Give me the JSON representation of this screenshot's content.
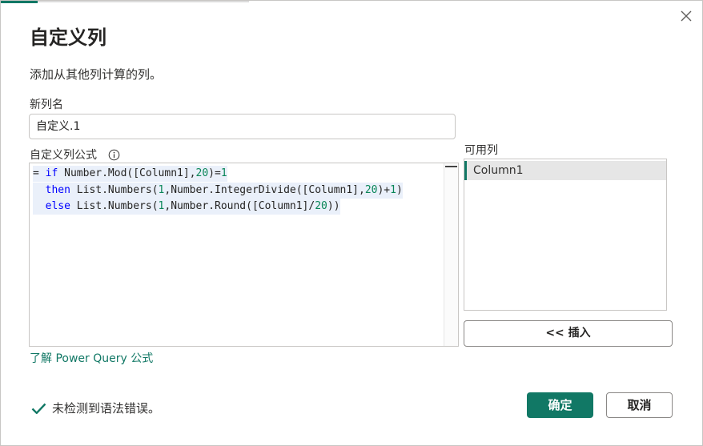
{
  "dialog": {
    "title": "自定义列",
    "subtitle": "添加从其他列计算的列。"
  },
  "new_column": {
    "label": "新列名",
    "value": "自定义.1"
  },
  "formula": {
    "label": "自定义列公式",
    "lines": [
      [
        {
          "t": "= ",
          "c": "plain"
        },
        {
          "t": "if",
          "c": "kw"
        },
        {
          "t": " Number.Mod([Column1],",
          "c": "plain"
        },
        {
          "t": "20",
          "c": "num"
        },
        {
          "t": ")=",
          "c": "plain"
        },
        {
          "t": "1",
          "c": "num"
        }
      ],
      [
        {
          "t": "  ",
          "c": "plain"
        },
        {
          "t": "then",
          "c": "kw"
        },
        {
          "t": " List.Numbers(",
          "c": "plain"
        },
        {
          "t": "1",
          "c": "num"
        },
        {
          "t": ",Number.IntegerDivide([Column1],",
          "c": "plain"
        },
        {
          "t": "20",
          "c": "num"
        },
        {
          "t": ")+",
          "c": "plain"
        },
        {
          "t": "1",
          "c": "num"
        },
        {
          "t": ")",
          "c": "plain"
        }
      ],
      [
        {
          "t": "  ",
          "c": "plain"
        },
        {
          "t": "else",
          "c": "kw"
        },
        {
          "t": " List.Numbers(",
          "c": "plain"
        },
        {
          "t": "1",
          "c": "num"
        },
        {
          "t": ",Number.Round([Column1]/",
          "c": "plain"
        },
        {
          "t": "20",
          "c": "num"
        },
        {
          "t": "))",
          "c": "plain"
        }
      ]
    ]
  },
  "available_columns": {
    "label": "可用列",
    "items": [
      "Column1"
    ],
    "selected_index": 0
  },
  "insert_button": "<< 插入",
  "learn_link": "了解 Power Query 公式",
  "status": {
    "text": "未检测到语法错误。",
    "icon": "checkmark-icon"
  },
  "buttons": {
    "ok": "确定",
    "cancel": "取消"
  },
  "colors": {
    "accent": "#117865",
    "keyword": "#0000ff",
    "number": "#098658",
    "line_highlight": "#eaf0fa"
  }
}
